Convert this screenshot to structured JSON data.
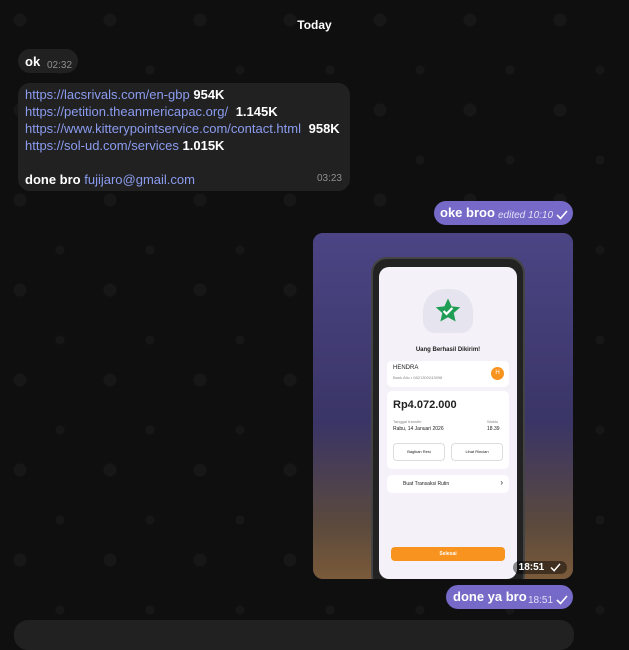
{
  "date_separator": "Today",
  "messages": {
    "m1": {
      "text": "ok",
      "time": "02:32"
    },
    "m2": {
      "links": [
        {
          "url": "https://lacsrivals.com/en-gbp",
          "count": "954K"
        },
        {
          "url": "https://petition.theanmericapac.org/",
          "count": "1.145K"
        },
        {
          "url": "https://www.kitterypointservice.com/contact.html",
          "count": "958K"
        },
        {
          "url": "https://sol-ud.com/services",
          "count": "1.015K"
        }
      ],
      "footer_text": "done bro",
      "email": "fujijaro@gmail.com",
      "time": "03:23"
    },
    "m3": {
      "text": "oke broo",
      "edited_label": "edited",
      "time": "10:10"
    },
    "m4": {
      "time": "18:51"
    },
    "m5": {
      "text": "done ya bro",
      "time": "18:51"
    }
  },
  "receipt": {
    "title": "Uang Berhasil Dikirim!",
    "name": "HENDRA",
    "account": "Bank Allo • 0821300243998",
    "initial": "H",
    "amount": "Rp4.072.000",
    "date_label": "Tanggal transfer",
    "date": "Rabu, 14 Januari 2026",
    "time_label": "Waktu",
    "time": "18.39",
    "share_label": "Bagikan Resi",
    "view_label": "Lihat Rincian",
    "routine_label": "Buat Transaksi Rutin",
    "done_label": "Selesai"
  },
  "colors": {
    "background": "#0f0f0f",
    "incoming_bubble": "#212121",
    "outgoing_bubble": "#766ac8",
    "link": "#8b9cf0",
    "accent_orange": "#f7931e",
    "success_green": "#1f9d55"
  }
}
